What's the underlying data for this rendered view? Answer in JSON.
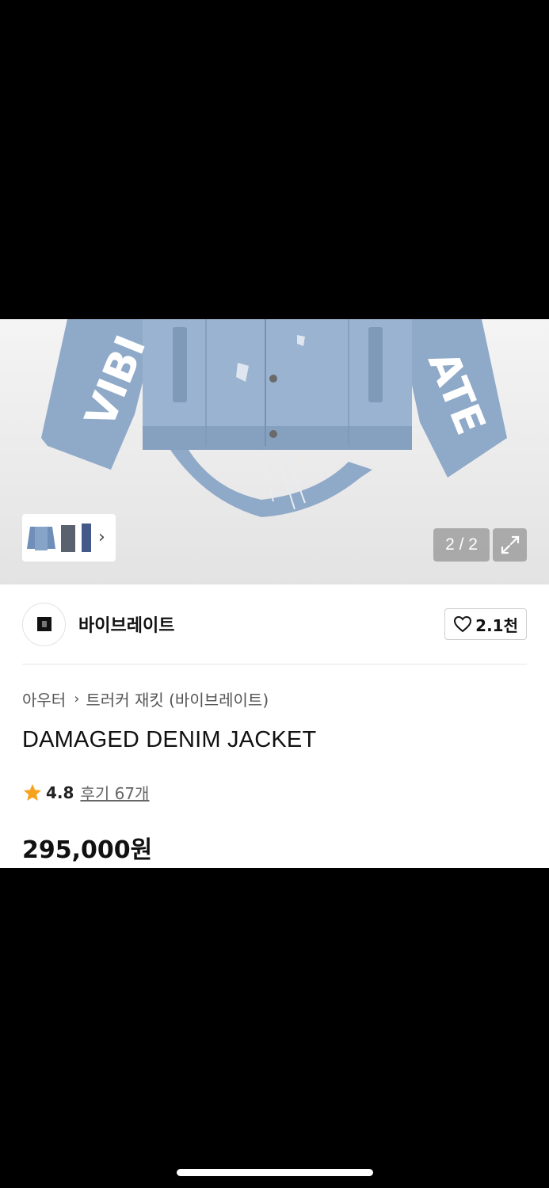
{
  "gallery": {
    "counter": "2 / 2",
    "image_text": "VIBRATE"
  },
  "brand": {
    "name": "바이브레이트",
    "likes": "2.1천"
  },
  "breadcrumb": {
    "category": "아우터",
    "subcategory": "트러커 재킷 (바이브레이트)"
  },
  "product": {
    "title": "DAMAGED DENIM JACKET",
    "rating": "4.8",
    "reviews": "후기 67개",
    "price": "295,000원"
  },
  "colors": {
    "star": "#f7a21b",
    "denim": "#8fa9c8"
  },
  "icons": [
    "chevron-right-icon",
    "expand-icon",
    "heart-icon",
    "star-icon"
  ]
}
